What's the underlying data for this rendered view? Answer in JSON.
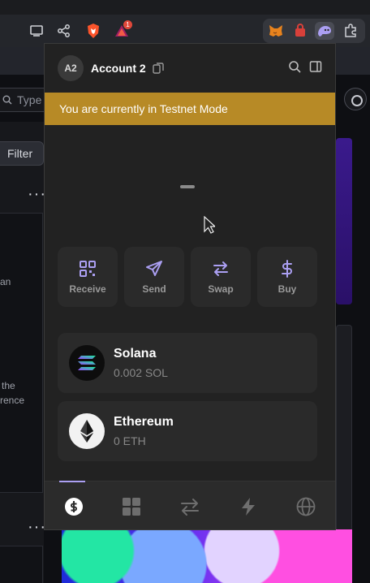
{
  "browser": {
    "toolbar_icons": [
      "cast-icon",
      "share-icon",
      "brave-shield-icon",
      "brave-rewards-icon"
    ],
    "rewards_badge": "1",
    "extensions": [
      "metamask-icon",
      "extension-red-icon",
      "phantom-icon",
      "extensions-puzzle-icon"
    ]
  },
  "background_page": {
    "search_placeholder": "Type",
    "filter_label": "Filter",
    "text_fragments": [
      "an",
      "the",
      "rence"
    ]
  },
  "wallet": {
    "header": {
      "avatar_initials": "A2",
      "account_name": "Account 2"
    },
    "banner": "You are currently in Testnet Mode",
    "actions": [
      {
        "label": "Receive",
        "icon": "qr-code-icon"
      },
      {
        "label": "Send",
        "icon": "send-icon"
      },
      {
        "label": "Swap",
        "icon": "swap-icon"
      },
      {
        "label": "Buy",
        "icon": "dollar-icon"
      }
    ],
    "tokens": [
      {
        "name": "Solana",
        "balance": "0.002 SOL",
        "icon": "solana-logo-icon"
      },
      {
        "name": "Ethereum",
        "balance": "0 ETH",
        "icon": "ethereum-logo-icon"
      }
    ],
    "tabs": [
      {
        "name": "tab-tokens",
        "icon": "dollar-circle-icon",
        "active": true
      },
      {
        "name": "tab-collectibles",
        "icon": "grid-icon",
        "active": false
      },
      {
        "name": "tab-swap",
        "icon": "swap-arrows-icon",
        "active": false
      },
      {
        "name": "tab-activity",
        "icon": "lightning-icon",
        "active": false
      },
      {
        "name": "tab-explore",
        "icon": "globe-icon",
        "active": false
      }
    ],
    "colors": {
      "accent": "#ab9ff2",
      "banner": "#b78a26",
      "surface": "#222222",
      "card": "#2a2a2a"
    }
  }
}
